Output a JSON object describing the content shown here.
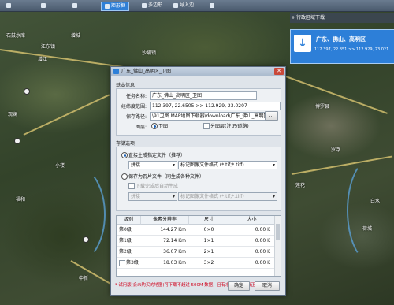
{
  "toolbar": {
    "items": [
      "",
      "",
      "",
      "矩形框",
      "多边形",
      "导入边",
      ""
    ]
  },
  "map_labels": [
    "石鼓水库",
    "江东镇",
    "增江",
    "增城",
    "沙埔镇",
    "观澜",
    "小楼",
    "福和",
    "博罗县",
    "罗浮",
    "莲花",
    "荷城",
    "白水",
    "中新"
  ],
  "right_panel": {
    "header": "行政区域下载",
    "task_title": "广东、佛山、高明区",
    "task_coords": "112.397, 22.851 >> 112.929, 23.021"
  },
  "dialog": {
    "title": "广东_佛山_高明区_卫图",
    "basic_section": "基本信息",
    "task_name_label": "任务名称:",
    "task_name_value": "广东_佛山_高明区_卫图",
    "coords_label": "经纬度范围:",
    "coords_value": "112.397, 22.6505  >>  112.929, 23.0207",
    "save_path_label": "保存路径:",
    "save_path_value": "\\91卫图 MAP地图下载器\\download\\广东_佛山_高明区",
    "browse_label": "...",
    "layer_label": "图层:",
    "layer_options": [
      "卫图",
      "分图层(注记/道路)"
    ],
    "storage_section": "存储选项",
    "opt_direct": "直接生成指定文件（推荐）",
    "opt_direct_select": "拼接",
    "opt_direct_format": "标记图像文件格式 (*.tif;*.tiff)",
    "opt_tiles": "保存为瓦片文件（同生成各种文件）",
    "opt_tiles_auto": "下载完成后自动生成",
    "opt_tiles_select": "拼接",
    "opt_tiles_format": "标记图像文件格式 (*.tif;*.tiff)",
    "table": {
      "headers": [
        "级别",
        "像素分辨率",
        "尺寸",
        "大小"
      ],
      "rows": [
        [
          "第0级",
          "144.27 Km",
          "0×0",
          "0.00 K"
        ],
        [
          "第1级",
          "72.14 Km",
          "1×1",
          "0.00 K"
        ],
        [
          "第2级",
          "36.07 Km",
          "2×1",
          "0.00 K"
        ],
        [
          "第3级",
          "18.03 Km",
          "3×2",
          "0.00 K"
        ]
      ]
    },
    "warning": "* 试用版(会未购买的地图)可下载不超过 500M 数据，且有水印，请升级正版。",
    "ok_label": "确定",
    "cancel_label": "取消"
  }
}
